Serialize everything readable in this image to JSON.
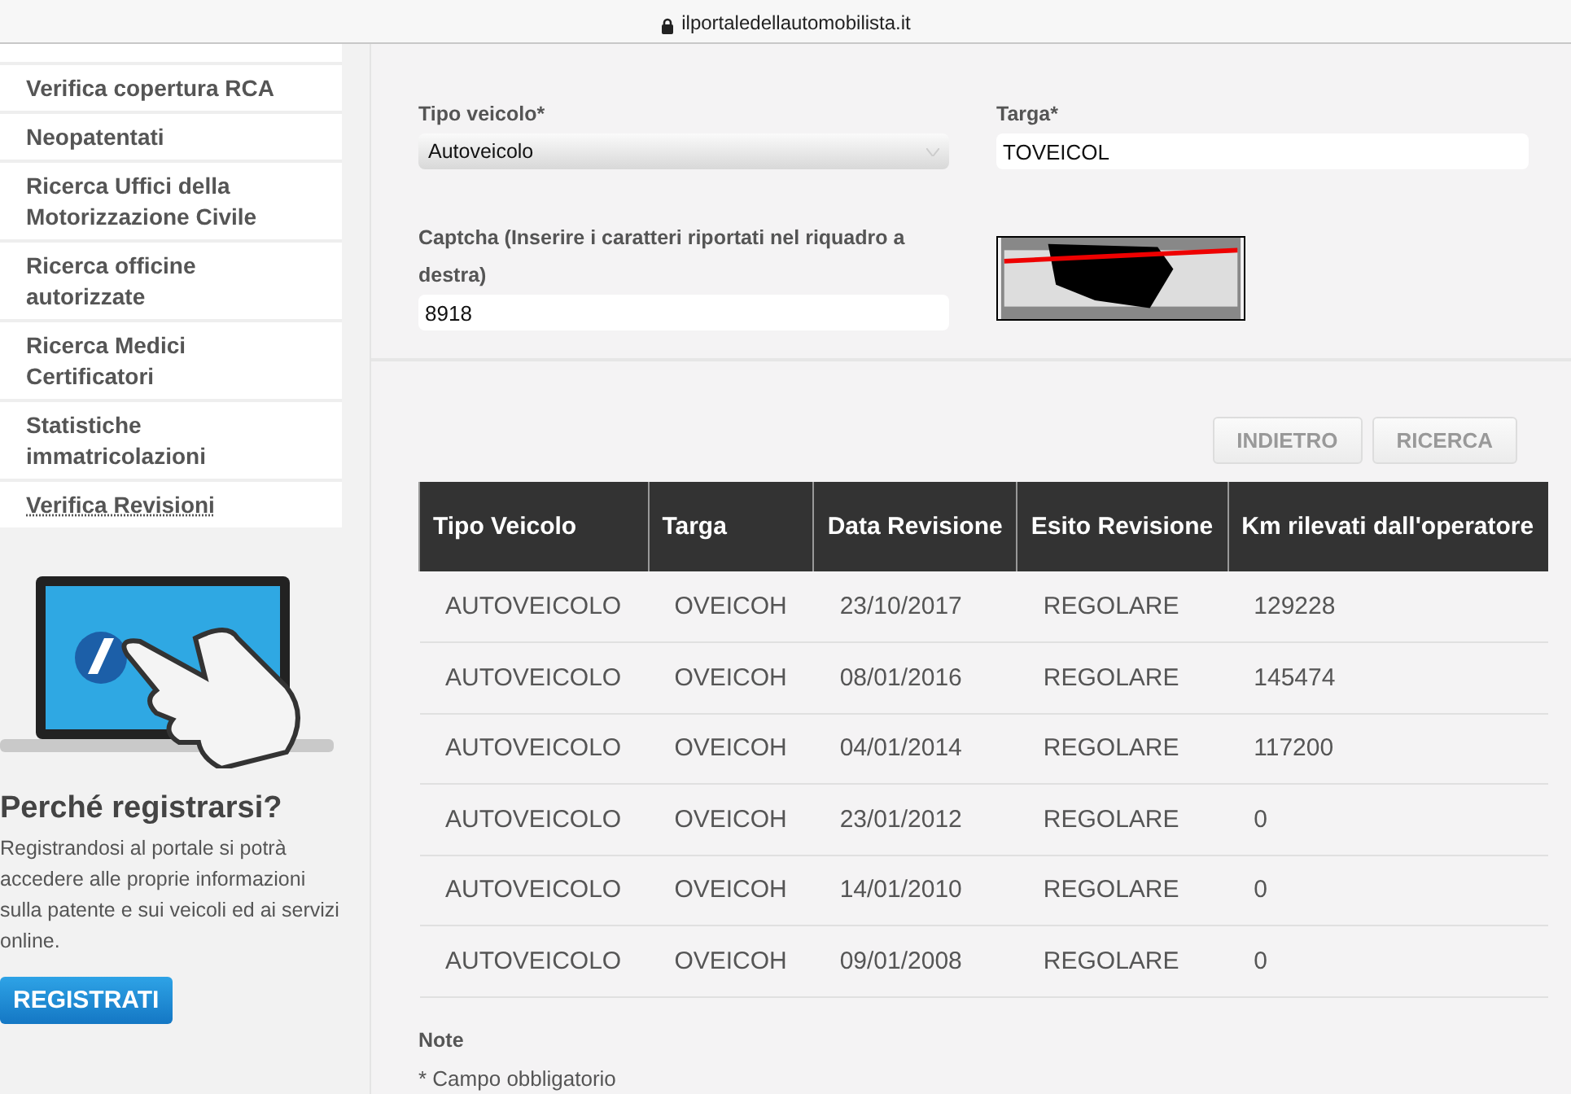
{
  "browser_bar": {
    "url": "ilportaledellautomobilista.it"
  },
  "sidebar": {
    "items": [
      {
        "label": "Verifica copertura RCA",
        "selected": false
      },
      {
        "label": "Neopatentati",
        "selected": false
      },
      {
        "label": "Ricerca Uffici della Motorizzazione Civile",
        "selected": false
      },
      {
        "label": "Ricerca officine autorizzate",
        "selected": false
      },
      {
        "label": "Ricerca Medici Certificatori",
        "selected": false
      },
      {
        "label": "Statistiche immatricolazioni",
        "selected": false
      },
      {
        "label": "Verifica Revisioni",
        "selected": true
      }
    ]
  },
  "promo": {
    "title": "Perché registrarsi?",
    "text": "Registrandosi al portale si potrà accedere alle proprie informazioni sulla patente e sui  veicoli ed ai servizi online.",
    "button": "REGISTRATI"
  },
  "form": {
    "vehicle_type": {
      "label": "Tipo veicolo*",
      "value": "Autoveicolo"
    },
    "plate": {
      "label": "Targa*",
      "value": "TOVEICOL"
    },
    "captcha": {
      "label": "Captcha (Inserire i caratteri riportati nel riquadro a destra)",
      "value": "8918"
    }
  },
  "buttons": [
    "INDIETRO",
    "RICERCA"
  ],
  "table": {
    "columns": [
      "Tipo Veicolo",
      "Targa",
      "Data Revisione",
      "Esito Revisione",
      "Km rilevati dall'operatore"
    ],
    "rows": [
      [
        "AUTOVEICOLO",
        "OVEICOH",
        "23/10/2017",
        "REGOLARE",
        "129228"
      ],
      [
        "AUTOVEICOLO",
        "OVEICOH",
        "08/01/2016",
        "REGOLARE",
        "145474"
      ],
      [
        "AUTOVEICOLO",
        "OVEICOH",
        "04/01/2014",
        "REGOLARE",
        "117200"
      ],
      [
        "AUTOVEICOLO",
        "OVEICOH",
        "23/01/2012",
        "REGOLARE",
        "0"
      ],
      [
        "AUTOVEICOLO",
        "OVEICOH",
        "14/01/2010",
        "REGOLARE",
        "0"
      ],
      [
        "AUTOVEICOLO",
        "OVEICOH",
        "09/01/2008",
        "REGOLARE",
        "0"
      ]
    ]
  },
  "notes": {
    "title": "Note",
    "text": "* Campo obbligatorio"
  }
}
